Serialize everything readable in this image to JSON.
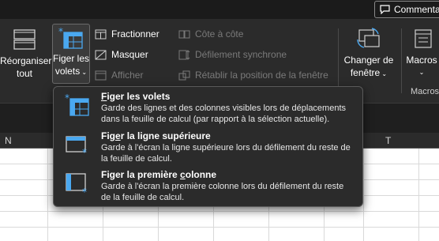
{
  "top": {
    "comments_label": "Commenta"
  },
  "ribbon": {
    "reorganiser": {
      "line1": "Réorganiser",
      "line2": "tout"
    },
    "figer": {
      "line1": "Figer les",
      "line2": "volets"
    },
    "fractionner": "Fractionner",
    "masquer": "Masquer",
    "afficher": "Afficher",
    "cote_a_cote": "Côte à côte",
    "defilement": "Défilement synchrone",
    "retablir": "Rétablir la position de la fenêtre",
    "changer": {
      "line1": "Changer de",
      "line2": "fenêtre"
    },
    "macros": "Macros",
    "macros_group": "Macros"
  },
  "columns": {
    "n": "N",
    "t": "T"
  },
  "menu": {
    "items": [
      {
        "title_u": "F",
        "title_rest": "iger les volets",
        "desc": "Garde des lignes et des colonnes visibles lors de déplacements dans la feuille de calcul (par rapport à la sélection actuelle)."
      },
      {
        "title_pre": "Fig",
        "title_u": "e",
        "title_rest": "r la ligne supérieure",
        "desc": "Garde à l'écran la ligne supérieure lors du défilement du reste de la feuille de calcul."
      },
      {
        "title_pre": "Figer la première ",
        "title_u": "c",
        "title_rest": "olonne",
        "desc": "Garde à l'écran la première colonne lors du défilement du reste de la feuille de calcul."
      }
    ]
  },
  "colors": {
    "accent_blue": "#4aa8f0",
    "menu_bg": "#2b2b2b",
    "ribbon_bg": "#2b2b2b"
  }
}
